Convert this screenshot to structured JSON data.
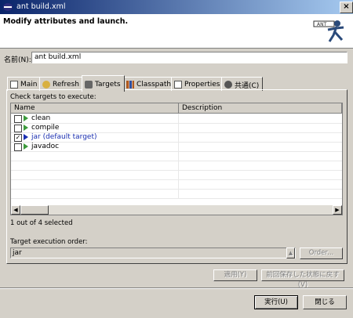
{
  "window": {
    "title": "ant build.xml",
    "close_glyph": "×"
  },
  "header": {
    "title": "Modify attributes and launch."
  },
  "name_field": {
    "label": "名前(N):",
    "value": "ant build.xml"
  },
  "tabs": [
    {
      "label": "Main",
      "icon": "main-tab-icon"
    },
    {
      "label": "Refresh",
      "icon": "refresh-icon"
    },
    {
      "label": "Targets",
      "icon": "targets-icon",
      "active": true
    },
    {
      "label": "Classpath",
      "icon": "classpath-icon"
    },
    {
      "label": "Properties",
      "icon": "properties-icon"
    },
    {
      "label": "共通(C)",
      "icon": "common-icon"
    }
  ],
  "targets": {
    "section_label": "Check targets to execute:",
    "columns": [
      "Name",
      "Description"
    ],
    "rows": [
      {
        "name": "clean",
        "checked": false
      },
      {
        "name": "compile",
        "checked": false
      },
      {
        "name": "jar (default target)",
        "checked": true
      },
      {
        "name": "javadoc",
        "checked": false
      }
    ],
    "status": "1 out of 4 selected",
    "scroll_left": "◀",
    "scroll_right": "▶"
  },
  "order": {
    "label": "Target execution order:",
    "value": "jar",
    "up_glyph": "▲",
    "button": "Order..."
  },
  "buttons": {
    "apply": "適用(Y)",
    "revert": "前回保存した状態に戻す(V)",
    "run": "実行(U)",
    "close": "閉じる"
  },
  "colors": {
    "title_start": "#0a246a",
    "title_end": "#a6caf0",
    "default_target": "#1a2fb0",
    "run_triangle": "#3c9a3c"
  }
}
